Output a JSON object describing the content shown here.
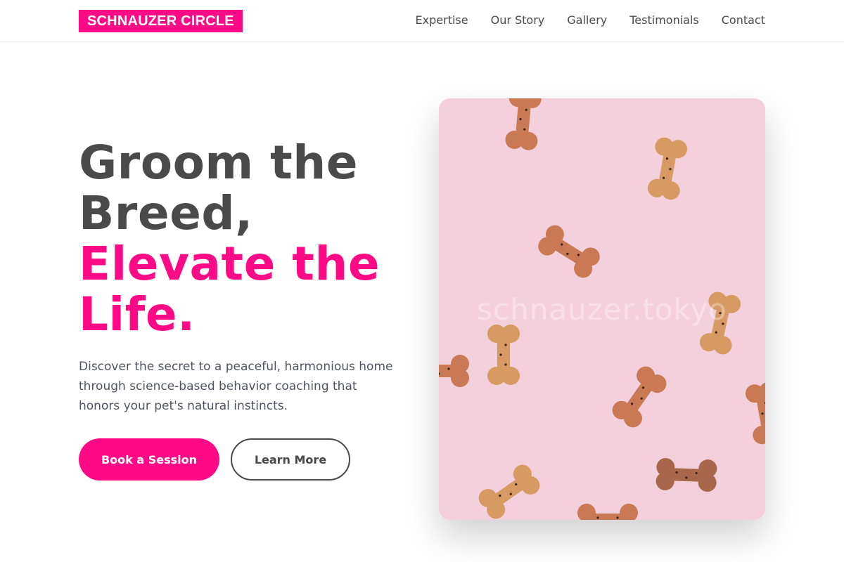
{
  "colors": {
    "accent": "#ff0a86",
    "text_dark": "#4a4a4a",
    "image_bg": "#f4cfdc"
  },
  "header": {
    "logo": "SCHNAUZER CIRCLE",
    "nav": [
      "Expertise",
      "Our Story",
      "Gallery",
      "Testimonials",
      "Contact"
    ]
  },
  "hero": {
    "headline_line1": "Groom the",
    "headline_line2": "Breed,",
    "headline_line3": "Elevate the",
    "headline_line4": "Life.",
    "description": "Discover the secret to a peaceful, harmonious home through science-based behavior coaching that honors your pet's natural instincts.",
    "primary_button": "Book a Session",
    "secondary_button": "Learn More",
    "image_watermark": "schnauzer.tokyo"
  }
}
